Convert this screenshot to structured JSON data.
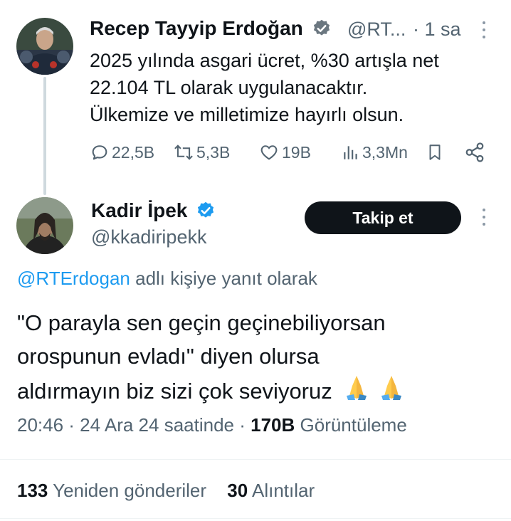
{
  "parent_tweet": {
    "author_name": "Recep Tayyip Erdoğan",
    "handle": "@RT...",
    "time": "· 1 sa",
    "text_lines": [
      "2025 yılında asgari ücret, %30 artışla net",
      "22.104 TL olarak uygulanacaktır.",
      "Ülkemize ve milletimize hayırlı olsun."
    ],
    "actions": {
      "replies": "22,5B",
      "reposts": "5,3B",
      "likes": "19B",
      "views": "3,3Mn"
    }
  },
  "reply_tweet": {
    "author_name": "Kadir İpek",
    "handle": "@kkadiripekk",
    "follow_label": "Takip et",
    "replying_mention": "@RTErdogan",
    "replying_suffix": " adlı kişiye yanıt olarak",
    "text_lines": [
      "\"O parayla sen geçin geçinebiliyorsan",
      "orospunun evladı\" diyen olursa",
      "aldırmayın biz sizi çok seviyoruz"
    ],
    "meta_time": "20:46 · 24 Ara 24 saatinde · ",
    "meta_views": "170B",
    "meta_views_label": " Görüntüleme",
    "reposts_count": "133",
    "reposts_label": " Yeniden gönderiler",
    "quotes_count": "30",
    "quotes_label": " Alıntılar"
  },
  "colors": {
    "text": "#0f1419",
    "secondary": "#536471",
    "accent": "#1d9bf0",
    "verified": "#1d9bf0",
    "thread_line": "#cfd9de"
  },
  "icons": [
    "verified-badge-icon",
    "more-icon",
    "reply-icon",
    "repost-icon",
    "like-icon",
    "views-icon",
    "bookmark-icon",
    "share-icon",
    "folded-hands-emoji"
  ]
}
